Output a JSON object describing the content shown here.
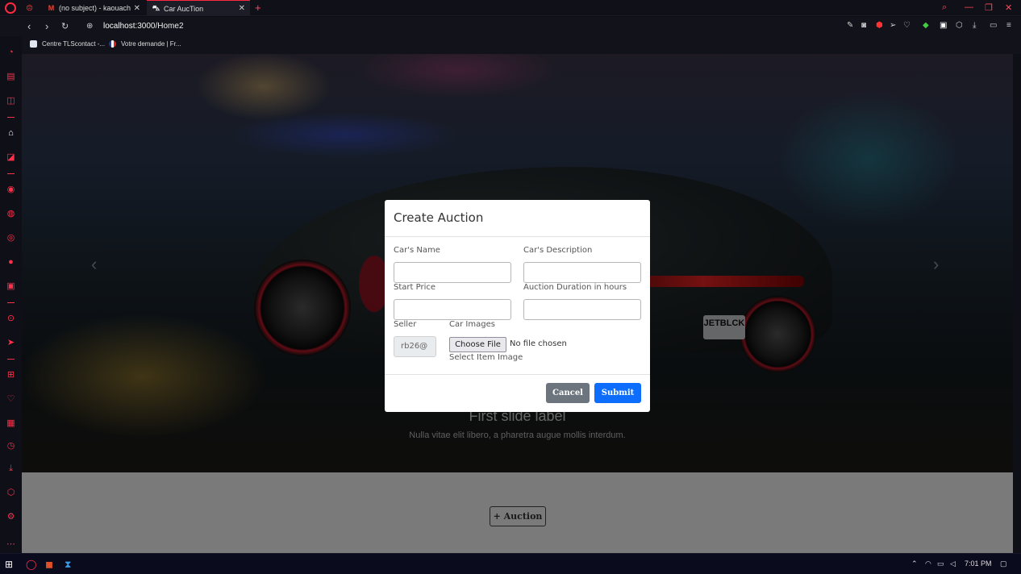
{
  "browser": {
    "tabs": [
      {
        "title": "(no subject) - kaouachimeh",
        "icon": "gmail-icon"
      },
      {
        "title": "Car AucTion",
        "icon": "car-icon",
        "active": true
      }
    ],
    "url_host": "localhost",
    "url_rest": ":3000/Home2",
    "bookmarks": [
      {
        "label": "Centre TLScontact -...",
        "icon": "tlscontact-icon"
      },
      {
        "label": "Votre demande | Fr...",
        "icon": "france-icon"
      }
    ]
  },
  "hero": {
    "caption_title": "First slide label",
    "caption_text": "Nulla vitae elit libero, a pharetra augue mollis interdum.",
    "plate": "JETBLCK"
  },
  "page": {
    "auction_button": "+ Auction"
  },
  "modal": {
    "title": "Create Auction",
    "car_name_label": "Car's Name",
    "car_name_value": "",
    "car_description_label": "Car's Description",
    "car_description_value": "",
    "start_price_label": "Start Price",
    "start_price_value": "",
    "duration_label": "Auction Duration in hours",
    "duration_value": "",
    "seller_label": "Seller",
    "seller_value": "rb26@",
    "car_images_label": "Car Images",
    "choose_file": "Choose File",
    "no_file": "No file chosen",
    "image_hint": "Select Item Image",
    "cancel": "Cancel",
    "submit": "Submit"
  },
  "taskbar": {
    "time": "7:01 PM"
  },
  "colors": {
    "accent": "#ff3048",
    "submit": "#0d6efd",
    "cancel": "#6c757d"
  }
}
